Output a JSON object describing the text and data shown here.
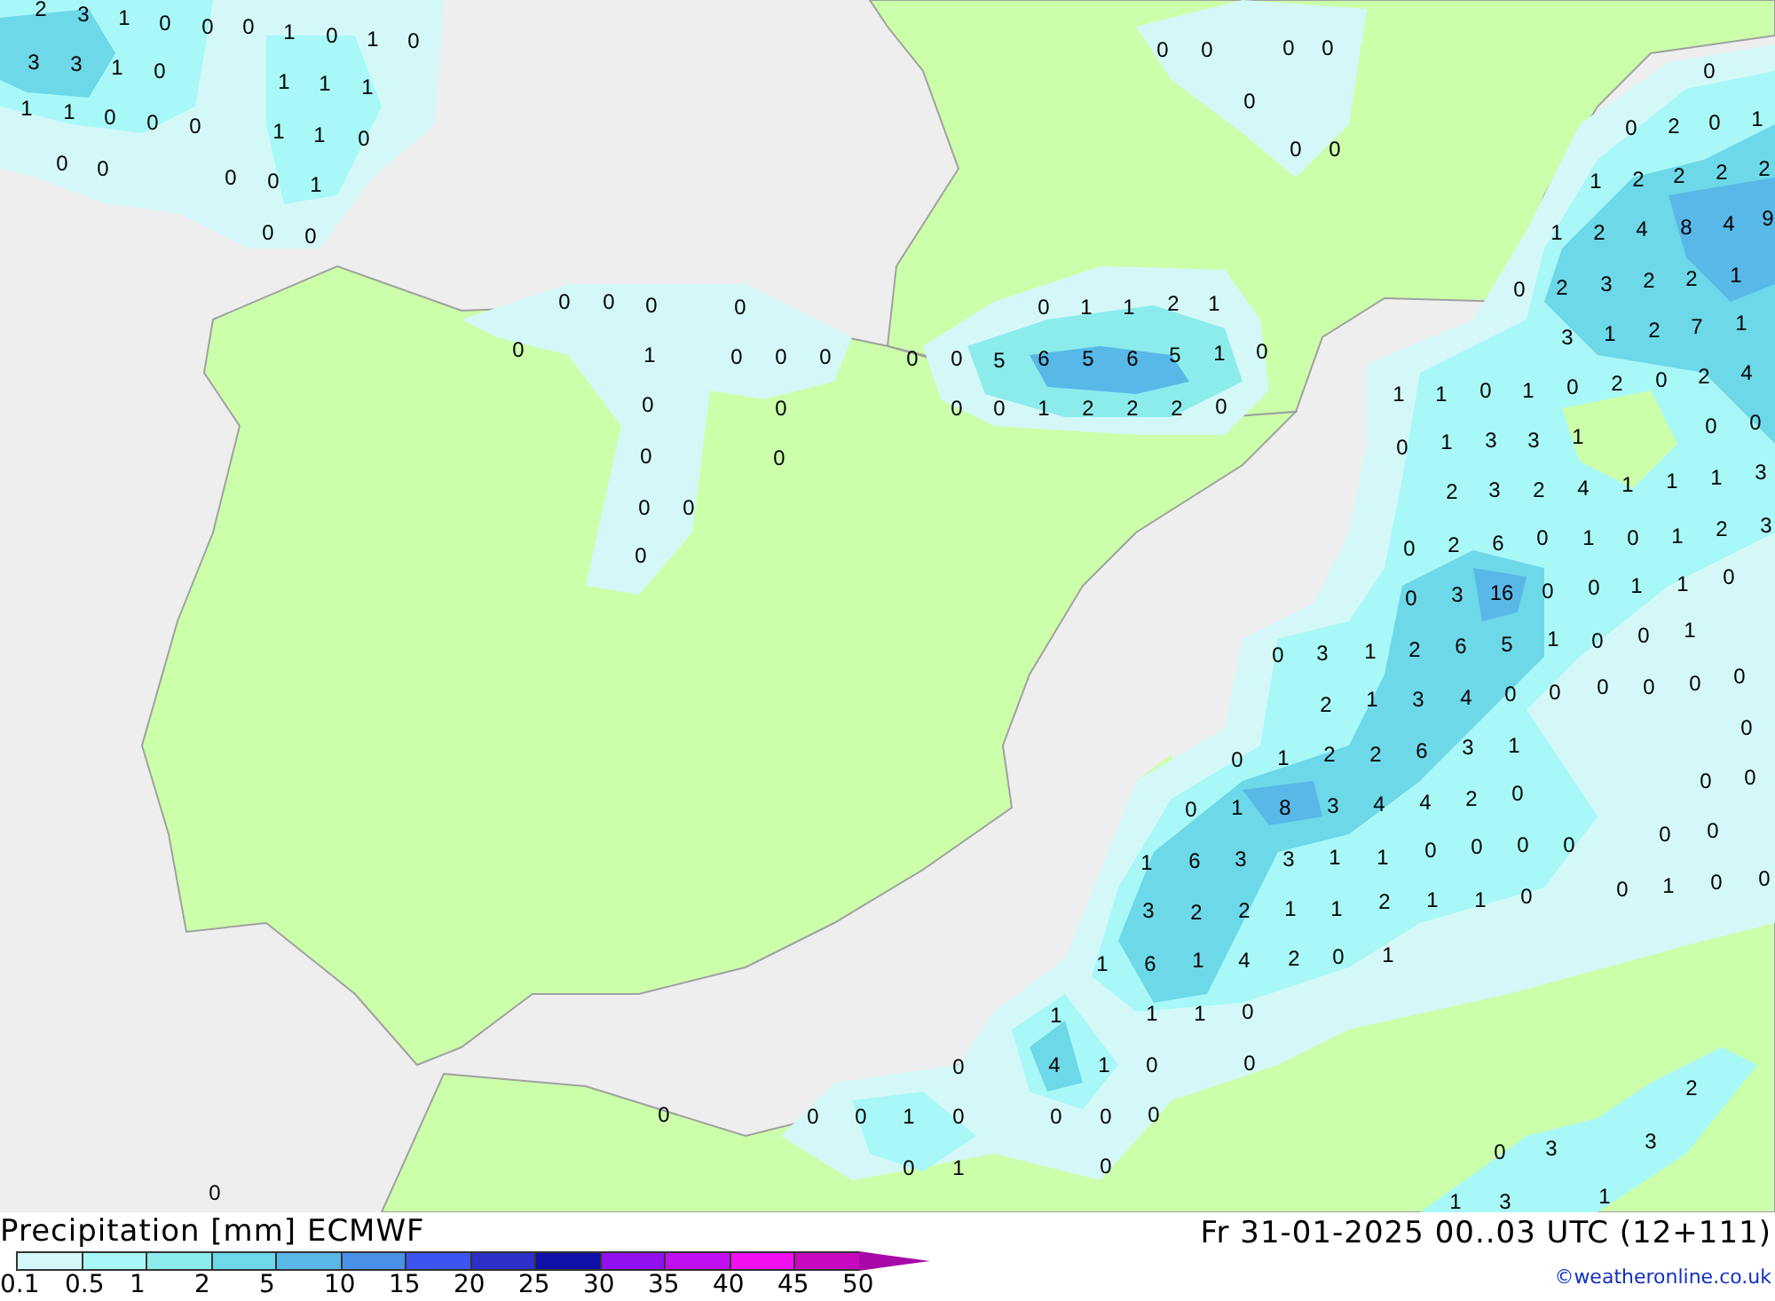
{
  "map_values": [
    "2",
    "3",
    "1",
    "0",
    "0",
    "0",
    "1",
    "0",
    "1",
    "0",
    "3",
    "3",
    "1",
    "0",
    "1",
    "1",
    "1",
    "1",
    "1",
    "0",
    "0",
    "0",
    "1",
    "1",
    "0",
    "0",
    "0",
    "0",
    "0",
    "1",
    "0",
    "0",
    "0",
    "0",
    "0",
    "0",
    "0",
    "0",
    "0",
    "0",
    "0",
    "0",
    "0",
    "0",
    "1",
    "0",
    "0",
    "0",
    "0",
    "0",
    "0",
    "0",
    "0",
    "0",
    "0",
    "0",
    "1",
    "1",
    "2",
    "1",
    "0",
    "0",
    "5",
    "6",
    "5",
    "6",
    "5",
    "1",
    "0",
    "0",
    "0",
    "1",
    "2",
    "2",
    "2",
    "0",
    "0",
    "0",
    "2",
    "0",
    "1",
    "1",
    "2",
    "2",
    "2",
    "2",
    "1",
    "2",
    "4",
    "8",
    "4",
    "9",
    "0",
    "2",
    "3",
    "2",
    "2",
    "1",
    "3",
    "1",
    "2",
    "7",
    "1",
    "1",
    "1",
    "0",
    "1",
    "0",
    "2",
    "0",
    "2",
    "4",
    "0",
    "0",
    "0",
    "1",
    "3",
    "3",
    "1",
    "2",
    "3",
    "2",
    "4",
    "1",
    "1",
    "1",
    "3",
    "0",
    "2",
    "6",
    "0",
    "1",
    "0",
    "1",
    "2",
    "3",
    "0",
    "3",
    "16",
    "0",
    "0",
    "1",
    "1",
    "0",
    "0",
    "3",
    "1",
    "2",
    "6",
    "5",
    "1",
    "0",
    "0",
    "1",
    "2",
    "1",
    "3",
    "4",
    "0",
    "0",
    "0",
    "0",
    "0",
    "0",
    "0",
    "0",
    "1",
    "2",
    "2",
    "6",
    "3",
    "1",
    "0",
    "0",
    "0",
    "1",
    "8",
    "3",
    "4",
    "4",
    "2",
    "0",
    "0",
    "0",
    "1",
    "6",
    "3",
    "3",
    "1",
    "1",
    "0",
    "0",
    "0",
    "0",
    "0",
    "1",
    "0",
    "0",
    "3",
    "2",
    "2",
    "1",
    "1",
    "2",
    "1",
    "1",
    "0",
    "1",
    "6",
    "1",
    "4",
    "2",
    "0",
    "1",
    "1",
    "1",
    "1",
    "0",
    "0",
    "4",
    "1",
    "0",
    "0",
    "0",
    "0",
    "0",
    "1",
    "0",
    "0",
    "0",
    "0",
    "0",
    "1",
    "0",
    "2",
    "0",
    "3",
    "3",
    "0",
    "1",
    "3",
    "1"
  ],
  "legend": {
    "title": "Precipitation [mm] ECMWF",
    "valid_time": "Fr 31-01-2025 00..03 UTC (12+111)",
    "credit": "©weatheronline.co.uk",
    "steps": [
      {
        "color": "#d4f8f8"
      },
      {
        "color": "#a8f8f8"
      },
      {
        "color": "#8cecec"
      },
      {
        "color": "#6cd8e8"
      },
      {
        "color": "#58b8e8"
      },
      {
        "color": "#4890e8"
      },
      {
        "color": "#3c54f0"
      },
      {
        "color": "#2c30c8"
      },
      {
        "color": "#1010a8"
      },
      {
        "color": "#9010f0"
      },
      {
        "color": "#c010f0"
      },
      {
        "color": "#f010f0"
      },
      {
        "color": "#c808c0"
      }
    ],
    "labels": [
      "0.1",
      "0.5",
      "1",
      "2",
      "5",
      "10",
      "15",
      "20",
      "25",
      "30",
      "35",
      "40",
      "45",
      "50"
    ]
  }
}
